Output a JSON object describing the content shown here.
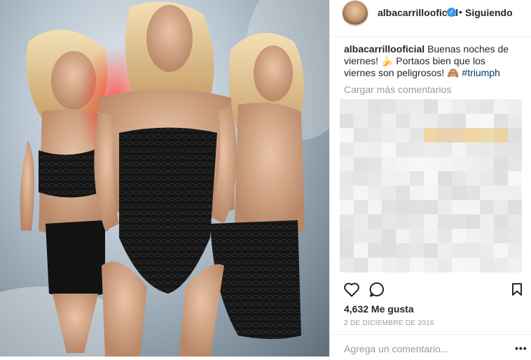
{
  "post": {
    "username": "albacarrillooficial",
    "verified_badge": "✓",
    "separator": "•",
    "follow_status": "Siguiendo",
    "caption_user": "albacarrillooficial",
    "caption_text": "Buenas noches de viernes! 🍌 Portaos bien que los viernes son peligrosos! 🙈",
    "caption_hashtag": "#triumph",
    "load_more": "Cargar más comentarios",
    "likes": "4,632 Me gusta",
    "date": "2 DE DICIEMBRE DE 2016",
    "comment_placeholder": "Agrega un comentario...",
    "options": "•••"
  },
  "icons": {
    "like": "heart-icon",
    "comment": "comment-icon",
    "save": "bookmark-icon"
  },
  "colors": {
    "link_blue": "#003569",
    "verified_blue": "#3897f0",
    "muted_text": "#999999",
    "primary_text": "#262626"
  }
}
